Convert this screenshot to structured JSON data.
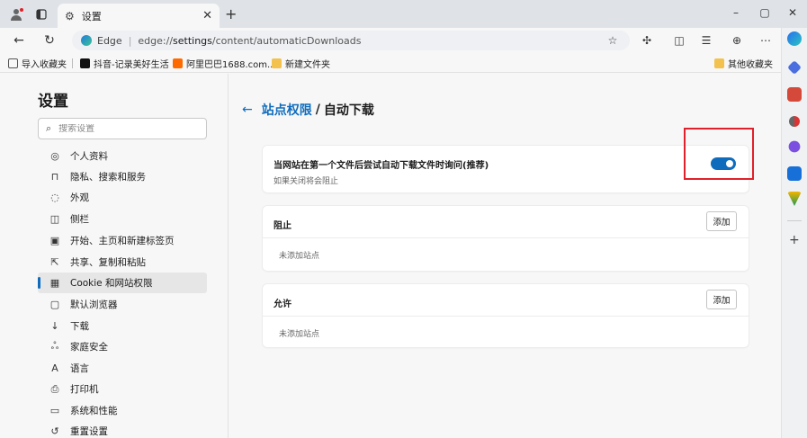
{
  "window": {
    "tab_title": "设置",
    "min_glyph": "–",
    "max_glyph": "▢",
    "close_glyph": "✕"
  },
  "address": {
    "site_label": "Edge",
    "url_prefix": "edge://",
    "url_host": "settings",
    "url_path": "/content/automaticDownloads"
  },
  "bookmarks": {
    "import_label": "导入收藏夹",
    "items": [
      "抖音-记录美好生活",
      "阿里巴巴1688.com...",
      "新建文件夹"
    ],
    "other_label": "其他收藏夹"
  },
  "settings": {
    "title": "设置",
    "search_placeholder": "搜索设置",
    "nav": [
      {
        "label": "个人资料",
        "icon": "person-icon"
      },
      {
        "label": "隐私、搜索和服务",
        "icon": "lock-icon"
      },
      {
        "label": "外观",
        "icon": "palette-icon"
      },
      {
        "label": "侧栏",
        "icon": "sidebar-icon"
      },
      {
        "label": "开始、主页和新建标签页",
        "icon": "home-icon"
      },
      {
        "label": "共享、复制和粘贴",
        "icon": "share-icon"
      },
      {
        "label": "Cookie 和网站权限",
        "icon": "cookie-icon"
      },
      {
        "label": "默认浏览器",
        "icon": "browser-icon"
      },
      {
        "label": "下载",
        "icon": "download-icon"
      },
      {
        "label": "家庭安全",
        "icon": "family-icon"
      },
      {
        "label": "语言",
        "icon": "language-icon"
      },
      {
        "label": "打印机",
        "icon": "printer-icon"
      },
      {
        "label": "系统和性能",
        "icon": "system-icon"
      },
      {
        "label": "重置设置",
        "icon": "reset-icon"
      }
    ],
    "active_index": 6
  },
  "main": {
    "breadcrumb_parent": "站点权限",
    "breadcrumb_sep": "/",
    "breadcrumb_current": "自动下载",
    "toggle_card": {
      "title": "当网站在第一个文件后尝试自动下载文件时询问(推荐)",
      "subtitle": "如果关闭将会阻止",
      "enabled": true
    },
    "block_card": {
      "title": "阻止",
      "add_label": "添加",
      "empty_text": "未添加站点"
    },
    "allow_card": {
      "title": "允许",
      "add_label": "添加",
      "empty_text": "未添加站点"
    }
  },
  "colors": {
    "accent": "#0f6cbd",
    "highlight": "#e0202a"
  }
}
